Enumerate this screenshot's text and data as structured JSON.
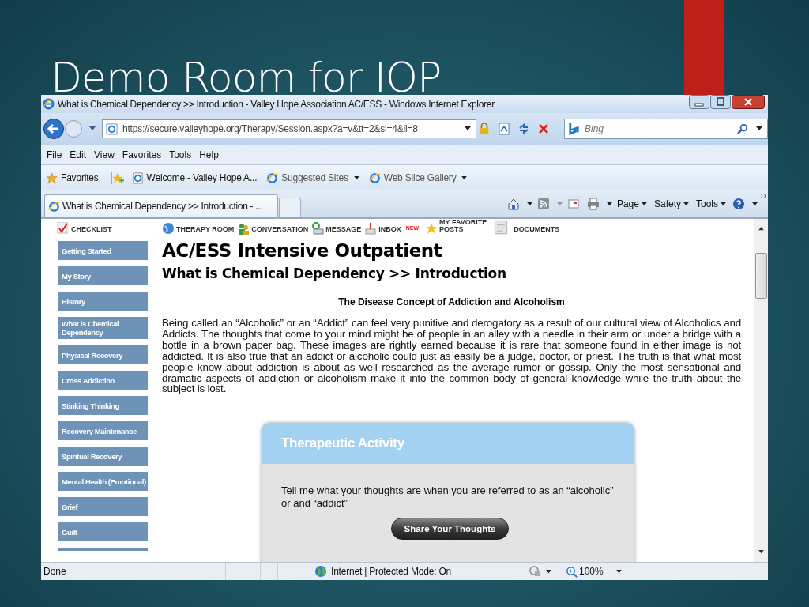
{
  "slide": {
    "title": "Demo Room for IOP"
  },
  "browser": {
    "title": "What is Chemical Dependency >> Introduction - Valley Hope Association AC/ESS - Windows Internet Explorer",
    "address": "https://secure.valleyhope.org/Therapy/Session.aspx?a=v&tt=2&si=4&li=8",
    "search": {
      "placeholder": "Bing"
    },
    "menu": [
      "File",
      "Edit",
      "View",
      "Favorites",
      "Tools",
      "Help"
    ],
    "favorites_bar": [
      {
        "label": "Favorites",
        "kind": "favorites"
      },
      {
        "label": "Welcome - Valley Hope A...",
        "kind": "page"
      },
      {
        "label": "Suggested Sites",
        "kind": "dropdown"
      },
      {
        "label": "Web Slice Gallery",
        "kind": "dropdown"
      }
    ],
    "tabs": [
      {
        "label": "What is Chemical Dependency >> Introduction - ...",
        "selected": true
      }
    ],
    "command_bar": [
      "Page",
      "Safety",
      "Tools"
    ],
    "status_bar": {
      "status": "Done",
      "zone": "Internet | Protected Mode: On",
      "zoom": "100%"
    }
  },
  "page": {
    "nav": [
      {
        "lines": [
          "CHECKLIST"
        ],
        "kind": "checklist"
      },
      {
        "lines": [
          "THERAPY ROOM"
        ],
        "kind": "therapy"
      },
      {
        "lines": [
          "CONVERSATION"
        ],
        "kind": "conversation"
      },
      {
        "lines": [
          "MESSAGE"
        ],
        "kind": "message"
      },
      {
        "lines": [
          "INBOX"
        ],
        "badge": "NEW",
        "kind": "inbox"
      },
      {
        "lines": [
          "MY FAVORITE",
          "POSTS"
        ],
        "kind": "favorite"
      },
      {
        "lines": [
          "DOCUMENTS"
        ],
        "kind": "documents"
      }
    ],
    "sidebar": [
      "Getting Started",
      "My Story",
      "History",
      "What is Chemical Dependency",
      "Physical Recovery",
      "Cross Addiction",
      "Stinking Thinking",
      "Recovery Maintenance",
      "Spiritual Recovery",
      "Mental Health (Emotional)",
      "Grief",
      "Guilt"
    ],
    "heading": "AC/ESS Intensive Outpatient",
    "subheading": "What is Chemical Dependency >> Introduction",
    "section_title": "The Disease Concept of Addiction and Alcoholism",
    "paragraph": "Being called an “Alcoholic” or an “Addict” can feel very punitive and derogatory as a result of our cultural view of Alcoholics and Addicts. The thoughts that come to your mind might be of people in an alley with a needle in their arm or under a bridge with a bottle in a brown paper bag. These images are rightly earned because it is rare that someone found in either image is not addicted. It is also true that an addict or alcoholic could just as easily be a judge, doctor, or priest. The truth is that what most people know about addiction is about as well researched as the average rumor or gossip. Only the most sensational and dramatic aspects of addiction or alcoholism make it into the common body of general knowledge while the truth about the subject is lost.",
    "activity": {
      "title": "Therapeutic Activity",
      "prompt": "Tell me what your thoughts are when you are referred to as an “alcoholic” or and “addict”",
      "button": "Share Your Thoughts"
    }
  }
}
